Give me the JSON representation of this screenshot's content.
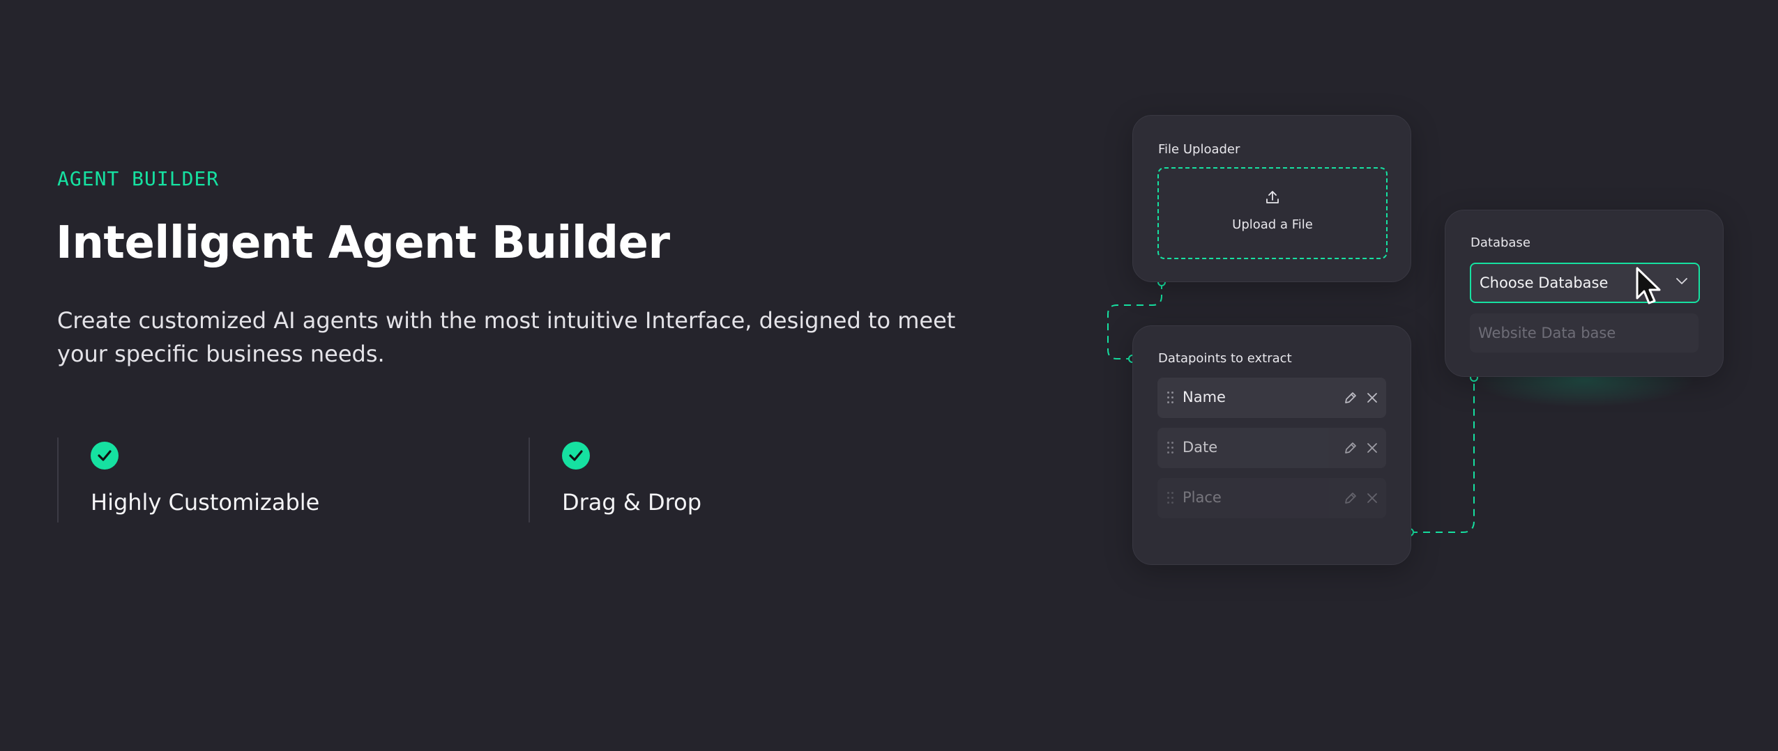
{
  "section": {
    "eyebrow": "AGENT BUILDER",
    "title": "Intelligent Agent Builder",
    "description": "Create customized AI agents with the most intuitive Interface, designed to meet your specific business needs."
  },
  "features": [
    {
      "label": "Highly Customizable",
      "icon": "check-circle-icon"
    },
    {
      "label": "Drag & Drop",
      "icon": "check-circle-icon"
    }
  ],
  "file_uploader": {
    "title": "File Uploader",
    "upload_label": "Upload a File",
    "icon": "upload-icon"
  },
  "datapoints": {
    "title": "Datapoints to extract",
    "items": [
      {
        "label": "Name"
      },
      {
        "label": "Date"
      },
      {
        "label": "Place"
      }
    ]
  },
  "database": {
    "title": "Database",
    "select_label": "Choose Database",
    "option_label": "Website Data base"
  },
  "colors": {
    "background": "#25242c",
    "accent": "#16e1a1",
    "card": "#2e2d36"
  }
}
